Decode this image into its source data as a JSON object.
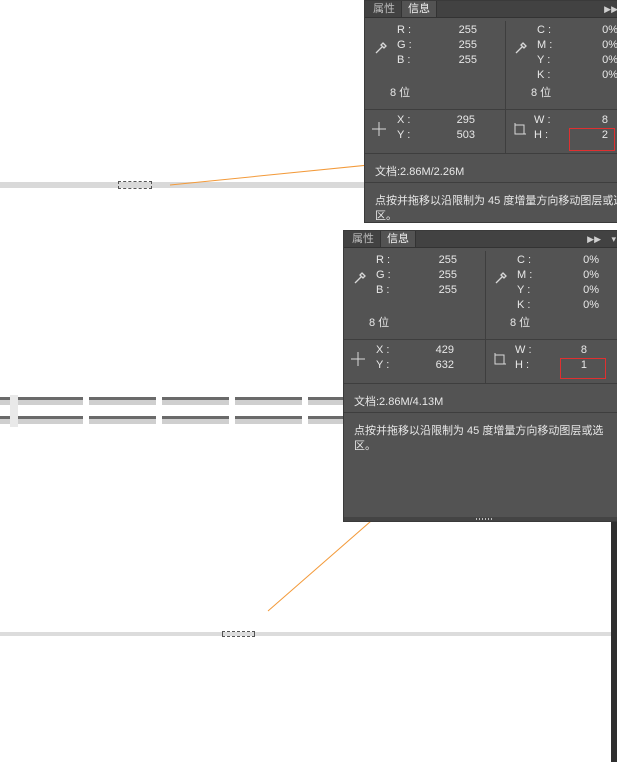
{
  "colors": {
    "panel_bg": "#535353",
    "accent_orange": "#f39a3a",
    "highlight_red": "#e03030"
  },
  "panel_top": {
    "tabs": [
      "属性",
      "信息"
    ],
    "color_rgb": {
      "r_label": "R :",
      "g_label": "G :",
      "b_label": "B :",
      "r": "255",
      "g": "255",
      "b": "255",
      "bits": "8 位"
    },
    "color_cmyk": {
      "c_label": "C :",
      "m_label": "M :",
      "y_label": "Y :",
      "k_label": "K :",
      "c": "0%",
      "m": "0%",
      "y": "0%",
      "k": "0%",
      "bits": "8 位"
    },
    "position": {
      "x_label": "X :",
      "y_label": "Y :",
      "x": "295",
      "y": "503"
    },
    "size": {
      "w_label": "W :",
      "h_label": "H :",
      "w": "8",
      "h": "2"
    },
    "doc": "文档:2.86M/2.26M",
    "hint_line1": "点按并拖移以沿限制为 45 度增量方向移动图层或选",
    "hint_line2": "区。"
  },
  "panel_bottom": {
    "tabs": [
      "属性",
      "信息"
    ],
    "color_rgb": {
      "r_label": "R :",
      "g_label": "G :",
      "b_label": "B :",
      "r": "255",
      "g": "255",
      "b": "255",
      "bits": "8 位"
    },
    "color_cmyk": {
      "c_label": "C :",
      "m_label": "M :",
      "y_label": "Y :",
      "k_label": "K :",
      "c": "0%",
      "m": "0%",
      "y": "0%",
      "k": "0%",
      "bits": "8 位"
    },
    "position": {
      "x_label": "X :",
      "y_label": "Y :",
      "x": "429",
      "y": "632"
    },
    "size": {
      "w_label": "W :",
      "h_label": "H :",
      "w": "8",
      "h": "1"
    },
    "doc": "文档:2.86M/4.13M",
    "hint_line1": "点按并拖移以沿限制为 45 度增量方向移动图层或选",
    "hint_line2": "区。"
  }
}
